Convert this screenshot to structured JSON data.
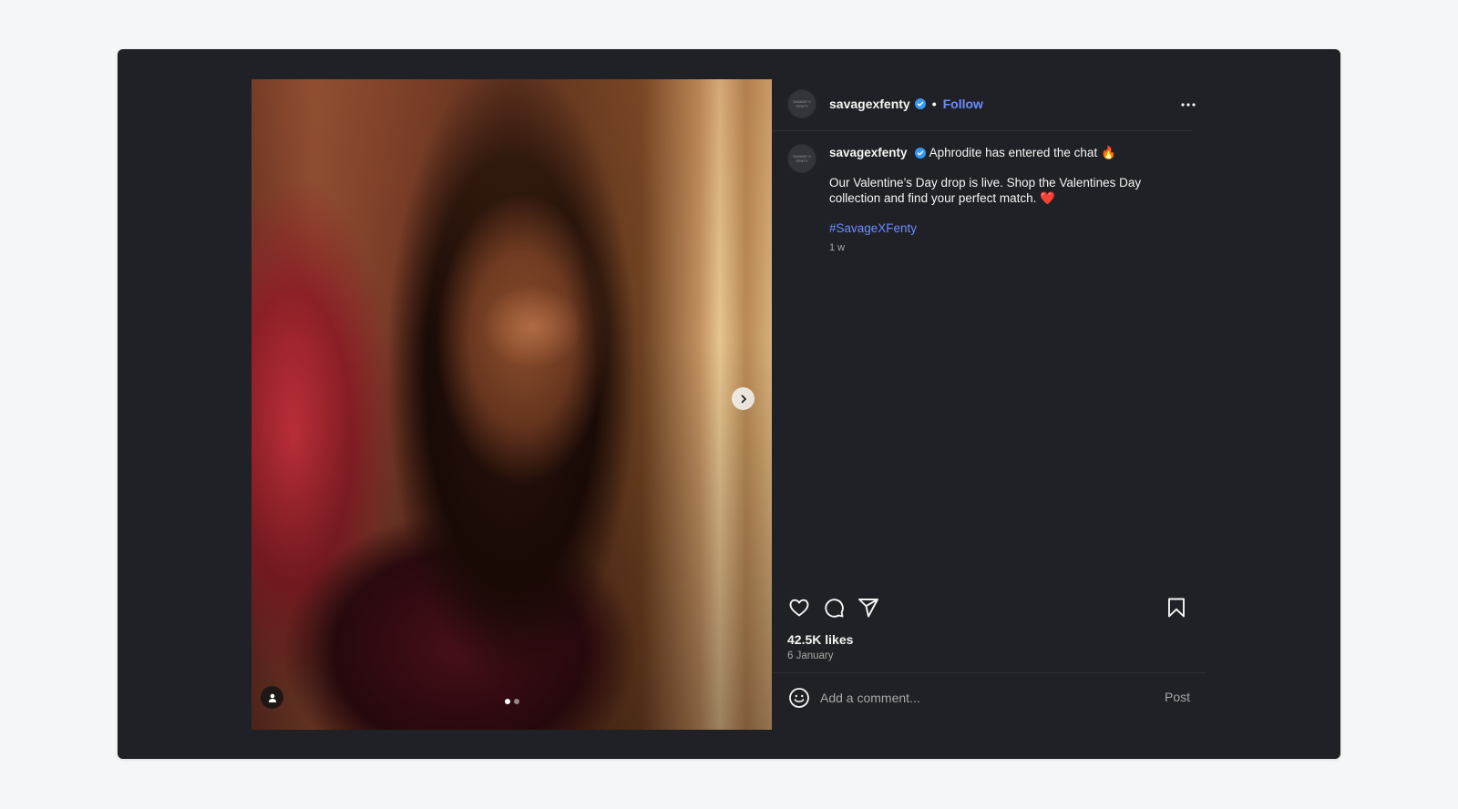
{
  "post": {
    "username": "savagexfenty",
    "avatar_text": "SAVAGE X FENTY",
    "follow_label": "Follow",
    "separator": "•",
    "more_icon": "more-horizontal-icon",
    "caption": {
      "headline": "Aphrodite has entered the chat 🔥",
      "body": "Our Valentine’s Day drop is live. Shop the Valentines Day collection and find your perfect match. ❤️",
      "hashtag": "#SavageXFenty",
      "age": "1 w"
    },
    "media": {
      "slide_count": 2,
      "active_slide": 1
    },
    "likes": "42.5K likes",
    "date": "6 January",
    "comment": {
      "placeholder": "Add a comment...",
      "post_label": "Post"
    }
  },
  "colors": {
    "background": "#f5f6f8",
    "panel": "#1f2126",
    "link": "#6b8cff",
    "verified": "#3897f0",
    "muted": "#a8a8a8"
  }
}
